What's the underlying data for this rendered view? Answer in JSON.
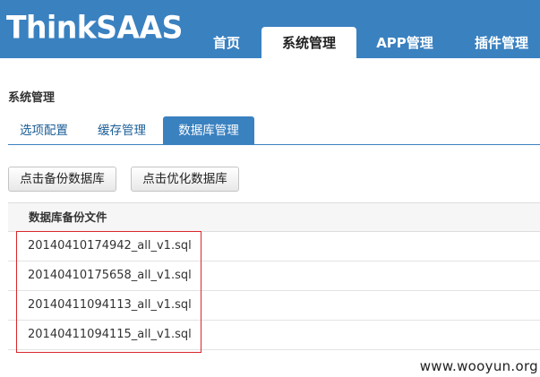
{
  "brand": {
    "logo_text": "ThinkSAAS"
  },
  "nav": {
    "tabs": [
      {
        "label": "首页"
      },
      {
        "label": "系统管理"
      },
      {
        "label": "APP管理"
      },
      {
        "label": "插件管理"
      }
    ],
    "active": "系统管理"
  },
  "page": {
    "title": "系统管理"
  },
  "subtabs": {
    "items": [
      {
        "label": "选项配置"
      },
      {
        "label": "缓存管理"
      },
      {
        "label": "数据库管理"
      }
    ],
    "active": "数据库管理"
  },
  "actions": {
    "backup_label": "点击备份数据库",
    "optimize_label": "点击优化数据库"
  },
  "table": {
    "header": "数据库备份文件",
    "rows": [
      "20140410174942_all_v1.sql",
      "20140410175658_all_v1.sql",
      "20140411094113_all_v1.sql",
      "20140411094115_all_v1.sql"
    ]
  },
  "watermark": "www.wooyun.org",
  "colors": {
    "header_bg": "#3a81c0",
    "highlight": "#d9262b"
  }
}
